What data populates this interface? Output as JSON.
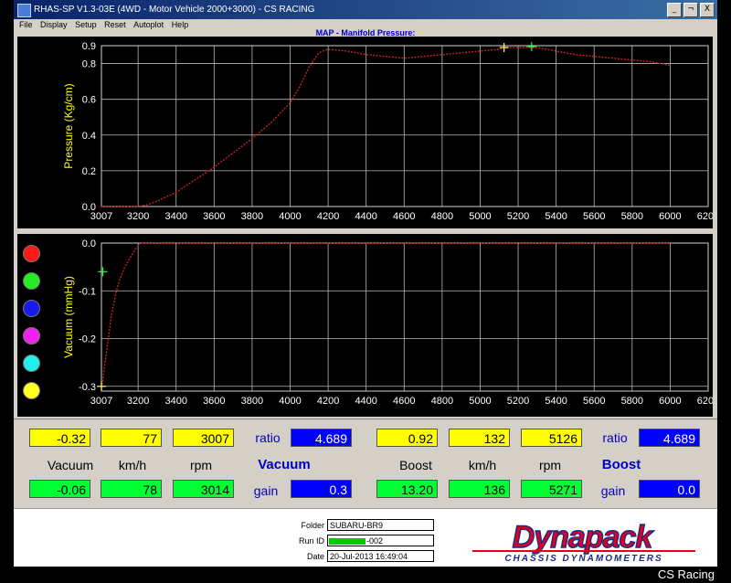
{
  "window": {
    "title": "RHAS-SP V1.3-03E (4WD - Motor Vehicle 2000+3000) - CS RACING"
  },
  "menu": [
    "File",
    "Display",
    "Setup",
    "Reset",
    "Autoplot",
    "Help"
  ],
  "window_controls": [
    "_",
    "¬",
    "X"
  ],
  "chart_title": "MAP - Manifold Pressure:",
  "colors": {
    "trace": "#cc1f1f",
    "grid": "#b8b8b8",
    "axis_label": "#ffff00",
    "marker_yellow": "#ffff66",
    "marker_green": "#33ff33"
  },
  "chart_data": [
    {
      "type": "line",
      "title": "MAP - Manifold Pressure:",
      "ylabel": "Pressure (Kg/cm)",
      "xlabel": "",
      "xlim": [
        3007,
        6200
      ],
      "ylim": [
        0,
        0.9
      ],
      "xticks": [
        "3007",
        "3200",
        "3400",
        "3600",
        "3800",
        "4000",
        "4200",
        "4400",
        "4600",
        "4800",
        "5000",
        "5200",
        "5400",
        "5600",
        "5800",
        "6000",
        "6200"
      ],
      "yticks": [
        "0.0",
        "0.2",
        "0.4",
        "0.6",
        "0.8",
        "0.9"
      ],
      "grid": true,
      "series": [
        {
          "x": [
            3007,
            3100,
            3200,
            3250,
            3300,
            3400,
            3500,
            3600,
            3700,
            3800,
            3900,
            4000,
            4050,
            4100,
            4150,
            4200,
            4300,
            4400,
            4500,
            4600,
            4700,
            4800,
            4900,
            5000,
            5100,
            5150,
            5200,
            5300,
            5400,
            5500,
            5600,
            5700,
            5800,
            5900,
            6000
          ],
          "y": [
            0.0,
            0.0,
            0.0,
            0.01,
            0.03,
            0.08,
            0.15,
            0.22,
            0.3,
            0.38,
            0.47,
            0.58,
            0.67,
            0.78,
            0.86,
            0.88,
            0.87,
            0.85,
            0.84,
            0.83,
            0.84,
            0.85,
            0.86,
            0.87,
            0.88,
            0.89,
            0.89,
            0.89,
            0.87,
            0.85,
            0.84,
            0.83,
            0.82,
            0.81,
            0.79
          ]
        }
      ],
      "markers": [
        {
          "x": 5126,
          "y": 0.89,
          "color": "yellow"
        },
        {
          "x": 5271,
          "y": 0.895,
          "color": "green"
        }
      ]
    },
    {
      "type": "line",
      "title": "",
      "ylabel": "Vacuum (mmHg)",
      "xlabel": "",
      "xlim": [
        3007,
        6200
      ],
      "ylim": [
        -0.31,
        0.0
      ],
      "xticks": [
        "3007",
        "3200",
        "3400",
        "3600",
        "3800",
        "4000",
        "4200",
        "4400",
        "4600",
        "4800",
        "5000",
        "5200",
        "5400",
        "5600",
        "5800",
        "6000",
        "6200"
      ],
      "yticks": [
        "-0.3",
        "-0.2",
        "-0.1",
        "0.0"
      ],
      "grid": true,
      "series": [
        {
          "x": [
            3007,
            3020,
            3040,
            3060,
            3080,
            3100,
            3130,
            3160,
            3190,
            3210,
            3240,
            6000
          ],
          "y": [
            -0.31,
            -0.27,
            -0.21,
            -0.15,
            -0.11,
            -0.08,
            -0.05,
            -0.03,
            -0.01,
            0.0,
            0.0,
            0.0
          ]
        }
      ],
      "markers": [
        {
          "x": 3014,
          "y": -0.06,
          "color": "green"
        },
        {
          "x": 3007,
          "y": -0.3,
          "color": "yellow"
        }
      ]
    }
  ],
  "dot_colors": [
    "#ff1a1a",
    "#22ee22",
    "#1a1aee",
    "#ee22ee",
    "#22eeee",
    "#ffff22"
  ],
  "vacuum_panel": {
    "row1": {
      "vacuum": "-0.32",
      "kmh": "77",
      "rpm": "3007",
      "ratio_label": "ratio",
      "ratio": "4.689"
    },
    "labels": {
      "vacuum": "Vacuum",
      "kmh": "km/h",
      "rpm": "rpm",
      "title": "Vacuum"
    },
    "row2": {
      "vacuum": "-0.06",
      "kmh": "78",
      "rpm": "3014",
      "gain_label": "gain",
      "gain": "0.3"
    }
  },
  "boost_panel": {
    "row1": {
      "boost": "0.92",
      "kmh": "132",
      "rpm": "5126",
      "ratio_label": "ratio",
      "ratio": "4.689"
    },
    "labels": {
      "boost": "Boost",
      "kmh": "km/h",
      "rpm": "rpm",
      "title": "Boost"
    },
    "row2": {
      "boost": "13.20",
      "kmh": "136",
      "rpm": "5271",
      "gain_label": "gain",
      "gain": "0.0"
    }
  },
  "footer": {
    "folder_label": "Folder",
    "folder": "SUBARU-BR9",
    "runid_label": "Run ID",
    "runid": "-002",
    "date_label": "Date",
    "date": "20-Jul-2013  16:49:04"
  },
  "logo": {
    "name": "Dynapack",
    "tagline": "CHASSIS DYNAMOMETERS"
  },
  "credit": "CS Racing"
}
